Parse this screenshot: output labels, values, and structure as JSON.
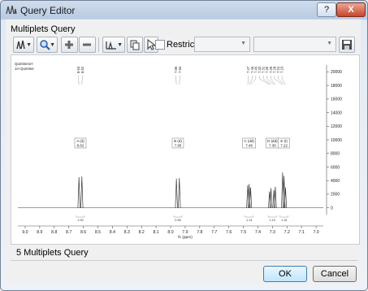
{
  "window": {
    "title": "Query Editor",
    "help_label": "?",
    "close_label": "X"
  },
  "group_label": "Multiplets Query",
  "toolbar": {
    "tools": [
      "query-type",
      "search",
      "add",
      "remove",
      "multiplet-class",
      "copy",
      "pointer"
    ],
    "restrict_label": "Restrict:",
    "restrict_checked": false,
    "combo1_value": "",
    "combo2_value": ""
  },
  "chart_data": {
    "type": "line",
    "legend": [
      "Quintine1H",
      "1H Quintine"
    ],
    "xlabel": "f1 (ppm)",
    "xlim": [
      9.05,
      6.95
    ],
    "x_ticks": [
      "9.0",
      "8.9",
      "8.8",
      "8.7",
      "8.6",
      "8.5",
      "8.4",
      "8.3",
      "8.2",
      "8.1",
      "8.0",
      "7.9",
      "7.8",
      "7.7",
      "7.6",
      "7.5",
      "7.4",
      "7.3",
      "7.2",
      "7.1",
      "7.0"
    ],
    "y_ticks": [
      "20000",
      "18000",
      "16000",
      "14000",
      "12000",
      "10000",
      "8000",
      "6000",
      "4000",
      "2000",
      "0"
    ],
    "ylim": [
      -1000,
      21000
    ],
    "peaks": [
      {
        "x": 8.63,
        "y": 4500
      },
      {
        "x": 8.61,
        "y": 4600
      },
      {
        "x": 7.96,
        "y": 4300
      },
      {
        "x": 7.94,
        "y": 4400
      },
      {
        "x": 7.47,
        "y": 3300
      },
      {
        "x": 7.46,
        "y": 3500
      },
      {
        "x": 7.45,
        "y": 3000
      },
      {
        "x": 7.32,
        "y": 2400
      },
      {
        "x": 7.31,
        "y": 2900
      },
      {
        "x": 7.29,
        "y": 2600
      },
      {
        "x": 7.28,
        "y": 3100
      },
      {
        "x": 7.23,
        "y": 5200
      },
      {
        "x": 7.22,
        "y": 4700
      },
      {
        "x": 7.21,
        "y": 3000
      }
    ],
    "peak_labels": [
      "8.63",
      "8.62",
      "7.96",
      "7.94",
      "7.47",
      "7.46",
      "7.45",
      "7.32",
      "7.31",
      "7.30",
      "7.29",
      "7.28",
      "7.24",
      "7.23"
    ],
    "multiplets": [
      {
        "label": "A (d)",
        "shift": "8.62",
        "x": 8.62
      },
      {
        "label": "B (d)",
        "shift": "7.95",
        "x": 7.95
      },
      {
        "label": "C (dd)",
        "shift": "7.46",
        "x": 7.46
      },
      {
        "label": "D (dd)",
        "shift": "7.30",
        "x": 7.3
      },
      {
        "label": "E (t)",
        "shift": "7.22",
        "x": 7.22
      }
    ],
    "integrals": [
      {
        "x": 8.62,
        "value": "1.00"
      },
      {
        "x": 7.95,
        "value": "0.98"
      },
      {
        "x": 7.46,
        "value": "1.14"
      },
      {
        "x": 7.3,
        "value": "1.10"
      },
      {
        "x": 7.22,
        "value": "1.15"
      }
    ]
  },
  "status_text": "5 Multiplets Query",
  "buttons": {
    "ok": "OK",
    "cancel": "Cancel"
  },
  "colors": {
    "spectrum": "#3a3a3a",
    "close": "#c8452a"
  }
}
